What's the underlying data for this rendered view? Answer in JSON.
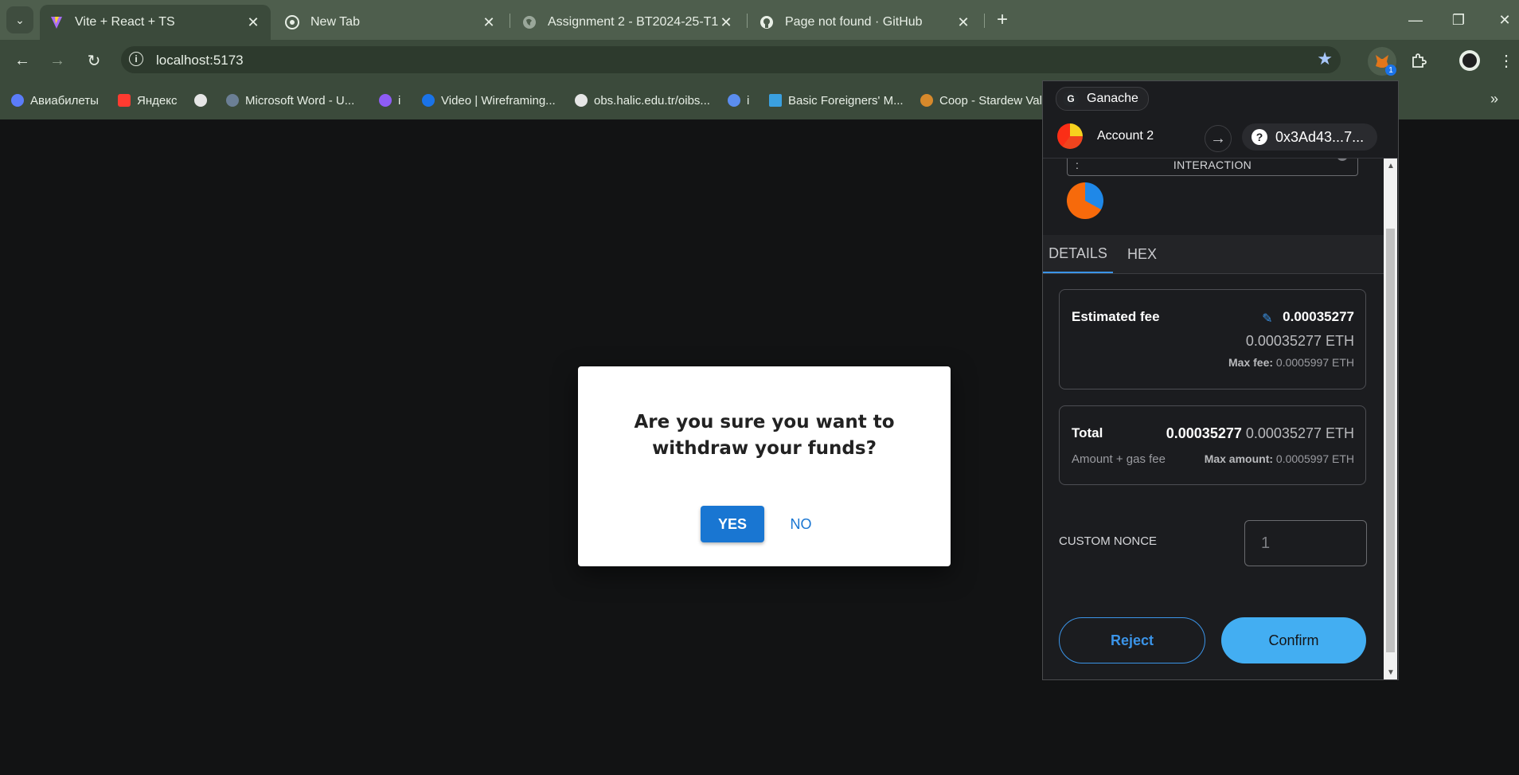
{
  "browser": {
    "tabs": [
      {
        "title": "Vite + React + TS",
        "icon": "vite-icon"
      },
      {
        "title": "New Tab",
        "icon": "chrome-icon"
      },
      {
        "title": "Assignment 2 - BT2024-25-T1 (",
        "icon": "globe-icon"
      },
      {
        "title": "Page not found · GitHub",
        "icon": "github-icon"
      }
    ],
    "new_tab": "+",
    "window_controls": {
      "minimize": "—",
      "restore": "❐",
      "close": "✕"
    },
    "url": "localhost:5173",
    "bookmarks": [
      {
        "label": "Авиабилеты",
        "color": "#5b7cfa"
      },
      {
        "label": "Яндекс",
        "color": "#ff3b30"
      },
      {
        "label": "",
        "color": "#e6e6e6"
      },
      {
        "label": "Microsoft Word - U...",
        "color": "#6b7f95"
      },
      {
        "label": "i",
        "color": "#8e5cf5"
      },
      {
        "label": "Video | Wireframing...",
        "color": "#1a73e8"
      },
      {
        "label": "obs.halic.edu.tr/oibs...",
        "color": "#e6e6e6"
      },
      {
        "label": "i",
        "color": "#5b8def"
      },
      {
        "label": "Basic Foreigners' M...",
        "color": "#3aa0e0"
      },
      {
        "label": "Coop - Stardew Val",
        "color": "#d7892b"
      }
    ],
    "extension_badge": "1"
  },
  "dialog": {
    "title": "Are you sure you want to withdraw your funds?",
    "yes": "YES",
    "no": "NO"
  },
  "wallet": {
    "network": "Ganache",
    "network_initial": "G",
    "account": "Account 2",
    "address": "0x3Ad43...7...",
    "interaction_label": "INTERACTION",
    "interaction_prefix": ":",
    "tabs": [
      "DETAILS",
      "HEX"
    ],
    "fee": {
      "label": "Estimated fee",
      "primary": "0.00035277",
      "secondary": "0.00035277 ETH",
      "max_label": "Max fee:",
      "max_value": "0.0005997 ETH"
    },
    "total": {
      "label": "Total",
      "primary": "0.00035277",
      "secondary": "0.00035277 ETH",
      "sub_label": "Amount + gas fee",
      "max_label": "Max amount:",
      "max_value": "0.0005997 ETH"
    },
    "nonce": {
      "label": "CUSTOM NONCE",
      "placeholder": "1"
    },
    "reject": "Reject",
    "confirm": "Confirm",
    "colors": {
      "accent": "#3b94e8",
      "confirm_bg": "#43aef2"
    }
  }
}
